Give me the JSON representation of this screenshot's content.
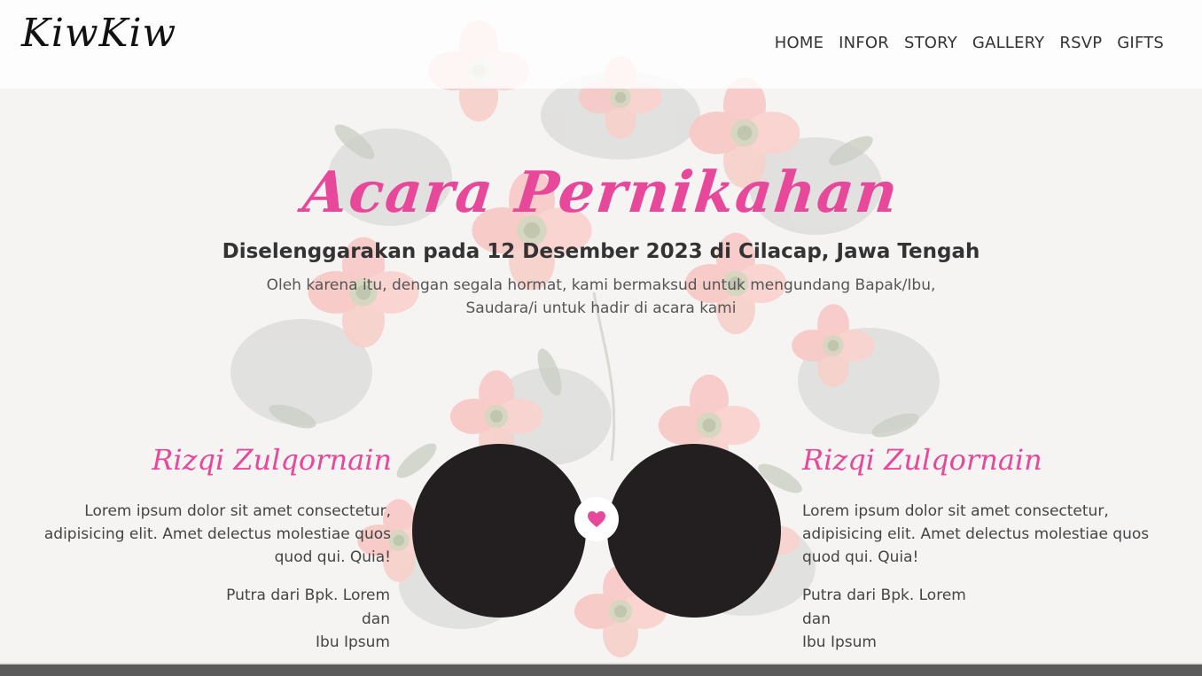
{
  "brand": {
    "logo_text": "KiwKiw"
  },
  "nav": {
    "items": [
      "HOME",
      "INFOR",
      "STORY",
      "GALLERY",
      "RSVP",
      "GIFTS"
    ]
  },
  "event": {
    "title": "Acara Pernikahan",
    "subtitle": "Diselenggarakan pada 12 Desember 2023 di Cilacap, Jawa Tengah",
    "description": "Oleh karena itu, dengan segala hormat, kami bermaksud untuk mengundang Bapak/Ibu, Saudara/i untuk hadir di acara kami"
  },
  "groom": {
    "name": "Rizqi Zulqornain",
    "bio": "Lorem ipsum dolor sit amet consectetur, adipisicing elit. Amet delectus molestiae quos quod qui. Quia!",
    "parent_line1": "Putra dari Bpk. Lorem",
    "parent_line2": "dan",
    "parent_line3": "Ibu Ipsum"
  },
  "bride": {
    "name": "Rizqi Zulqornain",
    "bio": "Lorem ipsum dolor sit amet consectetur, adipisicing elit. Amet delectus molestiae quos quod qui. Quia!",
    "parent_line1": "Putra dari Bpk. Lorem",
    "parent_line2": "dan",
    "parent_line3": "Ibu Ipsum"
  },
  "icons": {
    "center": "heart-icon"
  },
  "colors": {
    "accent": "#e8489a",
    "photo": "#231f20",
    "text": "#444444"
  }
}
